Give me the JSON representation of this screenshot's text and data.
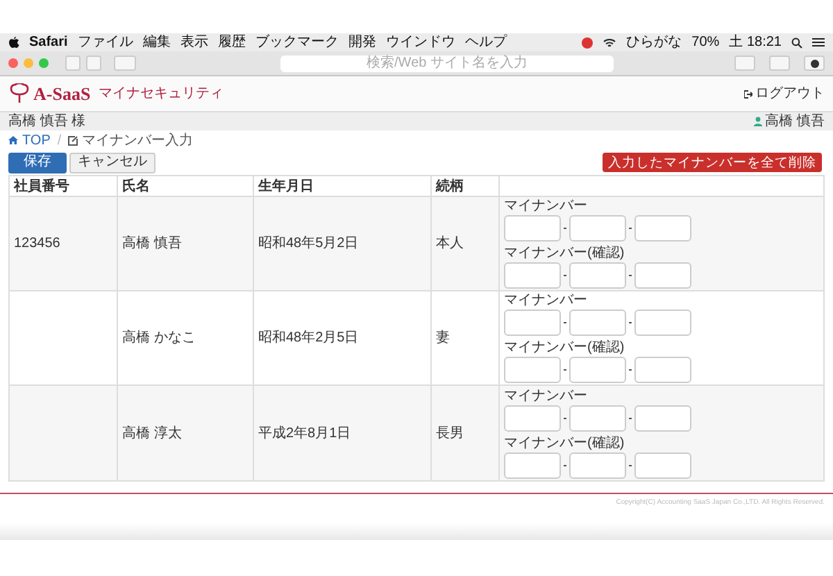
{
  "menubar": {
    "app": "Safari",
    "items": [
      "ファイル",
      "編集",
      "表示",
      "履歴",
      "ブックマーク",
      "開発",
      "ウインドウ",
      "ヘルプ"
    ],
    "input_method": "ひらがな",
    "battery": "70%",
    "clock": "土 18:21"
  },
  "browser": {
    "address_placeholder": "検索/Web サイト名を入力"
  },
  "header": {
    "logo": "A-SaaS",
    "app_name": "マイナセキュリティ",
    "logout": "ログアウト"
  },
  "user_bar": {
    "left": "高橋 慎吾 様",
    "right": "高橋 慎吾"
  },
  "breadcrumb": {
    "home": "TOP",
    "separator": "/",
    "current": "マイナンバー入力"
  },
  "actions": {
    "save": "保存",
    "cancel": "キャンセル",
    "delete_all": "入力したマイナンバーを全て削除"
  },
  "table": {
    "columns": [
      "社員番号",
      "氏名",
      "生年月日",
      "続柄"
    ],
    "rows": [
      {
        "employee_no": "123456",
        "name": "高橋 慎吾",
        "birth": "昭和48年5月2日",
        "relation": "本人",
        "fields": [
          "マイナンバー",
          "マイナンバー(確認)"
        ]
      },
      {
        "name": "高橋 かなこ",
        "birth": "昭和48年2月5日",
        "relation": "妻",
        "fields": [
          "マイナンバー",
          "マイナンバー(確認)"
        ]
      },
      {
        "name": "高橋 淳太",
        "birth": "平成2年8月1日",
        "relation": "長男",
        "fields": [
          "マイナンバー",
          "マイナンバー(確認)"
        ]
      }
    ]
  },
  "footer": {
    "copyright": "Copyright(C) Accounting SaaS Japan Co.,LTD. All Rights Reserved."
  }
}
